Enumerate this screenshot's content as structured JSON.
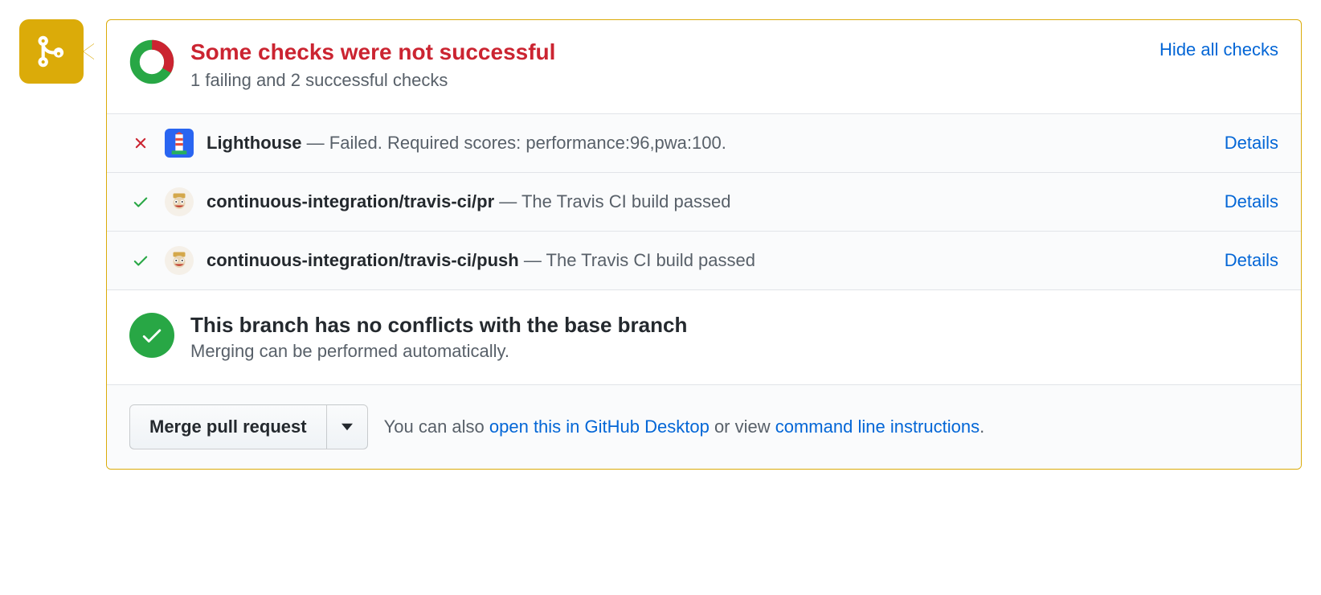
{
  "header": {
    "title": "Some checks were not successful",
    "subtitle": "1 failing and 2 successful checks",
    "hide_link": "Hide all checks"
  },
  "checks": [
    {
      "status": "fail",
      "avatar": "lighthouse",
      "name": "Lighthouse",
      "dash": "—",
      "message": "Failed. Required scores: performance:96,pwa:100.",
      "details": "Details"
    },
    {
      "status": "success",
      "avatar": "travis",
      "name": "continuous-integration/travis-ci/pr",
      "dash": "—",
      "message": "The Travis CI build passed",
      "details": "Details"
    },
    {
      "status": "success",
      "avatar": "travis",
      "name": "continuous-integration/travis-ci/push",
      "dash": "—",
      "message": "The Travis CI build passed",
      "details": "Details"
    }
  ],
  "conflicts": {
    "title": "This branch has no conflicts with the base branch",
    "subtitle": "Merging can be performed automatically."
  },
  "footer": {
    "merge_button": "Merge pull request",
    "prefix": "You can also ",
    "desktop_link": "open this in GitHub Desktop",
    "middle": " or view ",
    "cli_link": "command line instructions",
    "suffix": "."
  }
}
